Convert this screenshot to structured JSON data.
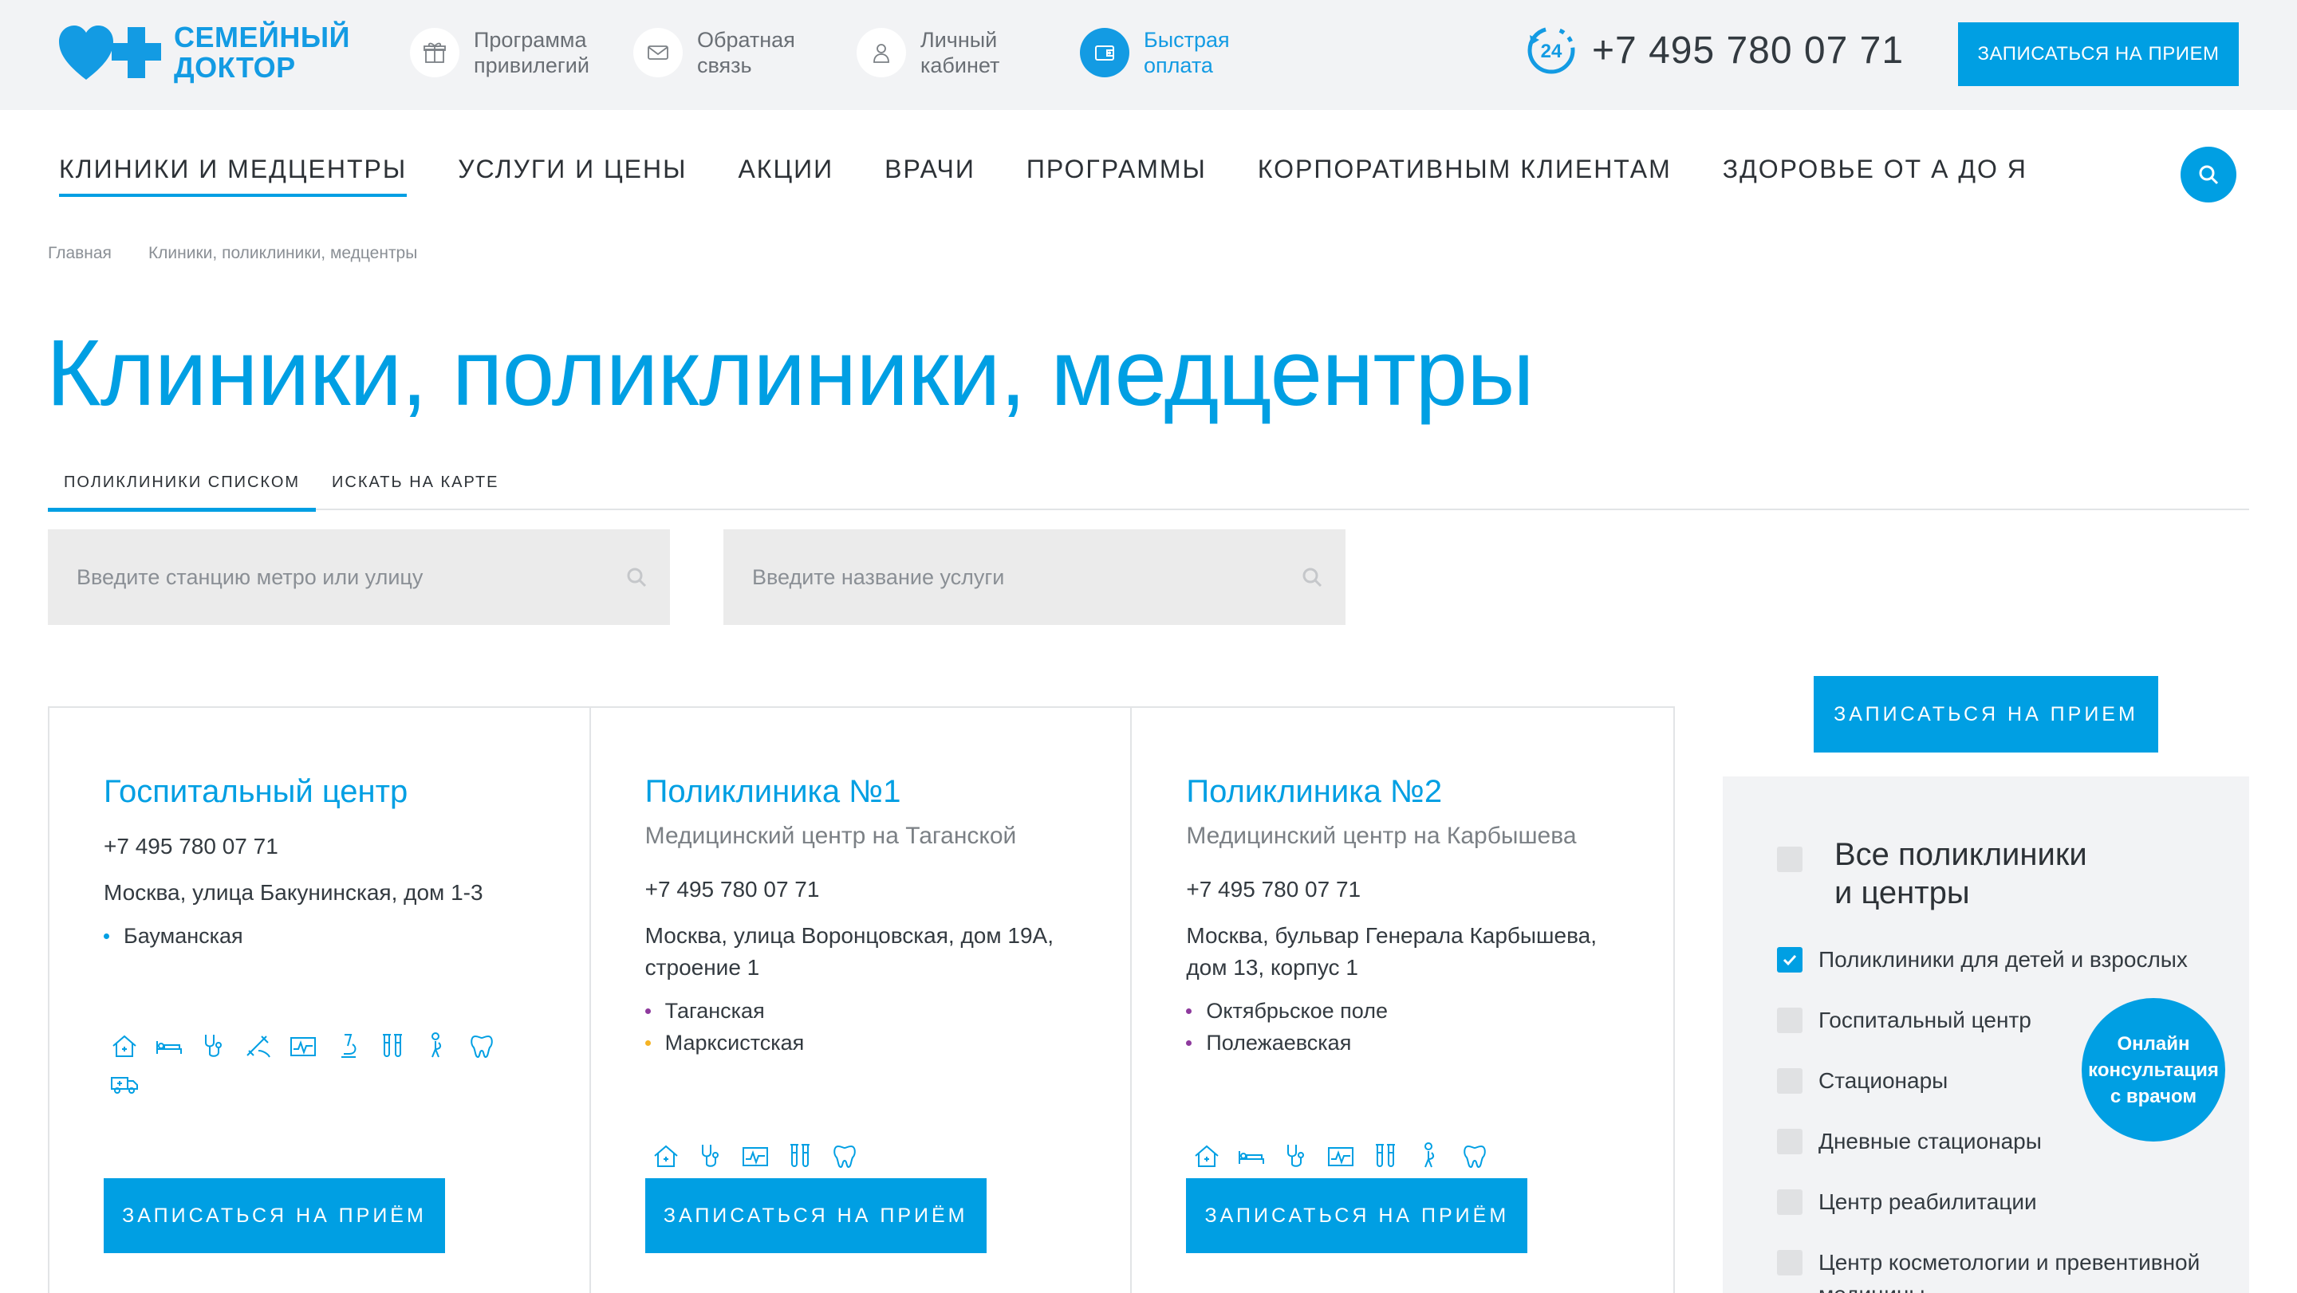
{
  "header": {
    "logo_line1": "СЕМЕЙНЫЙ",
    "logo_line2": "ДОКТОР",
    "items": [
      {
        "label_1": "Программа",
        "label_2": "привилегий",
        "icon": "gift-icon"
      },
      {
        "label_1": "Обратная",
        "label_2": "связь",
        "icon": "mail-icon"
      },
      {
        "label_1": "Личный",
        "label_2": "кабинет",
        "icon": "user-icon"
      },
      {
        "label_1": "Быстрая",
        "label_2": "оплата",
        "icon": "wallet-icon"
      }
    ],
    "phone": "+7 495 780 07 71",
    "phone_badge": "24",
    "cta": "ЗАПИСАТЬСЯ НА ПРИЕМ"
  },
  "nav": {
    "items": [
      "КЛИНИКИ И МЕДЦЕНТРЫ",
      "УСЛУГИ И ЦЕНЫ",
      "АКЦИИ",
      "ВРАЧИ",
      "ПРОГРАММЫ",
      "КОРПОРАТИВНЫМ КЛИЕНТАМ",
      "ЗДОРОВЬЕ ОТ А ДО Я"
    ],
    "active_index": 0
  },
  "breadcrumb": [
    "Главная",
    "Клиники, поликлиники, медцентры"
  ],
  "page_title": "Клиники, поликлиники, медцентры",
  "tabs": [
    "ПОЛИКЛИНИКИ СПИСКОМ",
    "ИСКАТЬ НА КАРТЕ"
  ],
  "filters": {
    "metro_placeholder": "Введите станцию метро или улицу",
    "service_placeholder": "Введите название услуги"
  },
  "cards": [
    {
      "title": "Госпитальный центр",
      "subtitle": "",
      "phone": "+7 495 780 07 71",
      "address": "Москва, улица Бакунинская, дом 1-3",
      "metro": [
        {
          "name": "Бауманская",
          "color": "#009fe3"
        }
      ],
      "button": "ЗАПИСАТЬСЯ НА ПРИЁМ"
    },
    {
      "title": "Поликлиника №1",
      "subtitle": "Медицинский центр на Таганской",
      "phone": "+7 495 780 07 71",
      "address": "Москва, улица Воронцовская, дом 19А, строение 1",
      "metro": [
        {
          "name": "Таганская",
          "color": "#8e3a9d"
        },
        {
          "name": "Марксистская",
          "color": "#f5b324"
        }
      ],
      "button": "ЗАПИСАТЬСЯ НА ПРИЁМ"
    },
    {
      "title": "Поликлиника №2",
      "subtitle": "Медицинский центр на Карбышева",
      "phone": "+7 495 780 07 71",
      "address": "Москва, бульвар Генерала Карбышева, дом 13, корпус 1",
      "metro": [
        {
          "name": "Октябрьское поле",
          "color": "#8e3a9d"
        },
        {
          "name": "Полежаевская",
          "color": "#8e3a9d"
        }
      ],
      "button": "ЗАПИСАТЬСЯ НА ПРИЁМ"
    }
  ],
  "sidebar": {
    "button": "ЗАПИСАТЬСЯ НА ПРИЕМ",
    "all_label_1": "Все поликлиники",
    "all_label_2": "и центры",
    "items": [
      {
        "label": "Поликлиники для детей и взрослых",
        "checked": true
      },
      {
        "label": "Госпитальный центр",
        "checked": false
      },
      {
        "label": "Стационары",
        "checked": false
      },
      {
        "label": "Дневные стационары",
        "checked": false
      },
      {
        "label": "Центр реабилитации",
        "checked": false
      },
      {
        "label": "Центр косметологии и превентивной медицины",
        "checked": false
      }
    ]
  },
  "consult_badge": {
    "line1": "Онлайн",
    "line2": "консультация",
    "line3": "с врачом"
  },
  "colors": {
    "accent": "#009fe3",
    "panel": "#f2f3f5"
  }
}
